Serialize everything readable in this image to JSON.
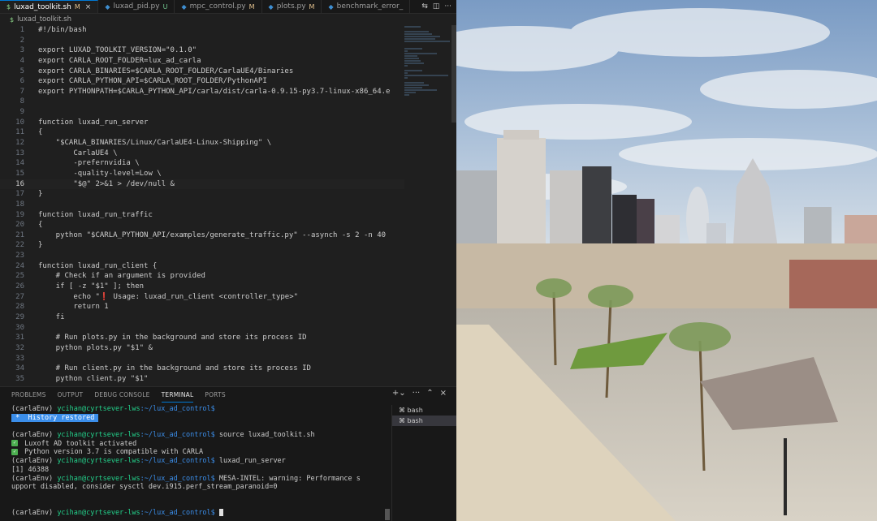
{
  "tabs": [
    {
      "name": "luxad_toolkit.sh",
      "status": "M",
      "type": "sh",
      "active": true
    },
    {
      "name": "luxad_pid.py",
      "status": "U",
      "type": "py",
      "active": false
    },
    {
      "name": "mpc_control.py",
      "status": "M",
      "type": "py",
      "active": false
    },
    {
      "name": "plots.py",
      "status": "M",
      "type": "py",
      "active": false
    },
    {
      "name": "benchmark_error_",
      "status": "",
      "type": "py",
      "active": false
    }
  ],
  "breadcrumb": "luxad_toolkit.sh",
  "code_lines": [
    {
      "n": "1",
      "t": "#!/bin/bash"
    },
    {
      "n": "2",
      "t": ""
    },
    {
      "n": "3",
      "t": "export LUXAD_TOOLKIT_VERSION=\"0.1.0\""
    },
    {
      "n": "4",
      "t": "export CARLA_ROOT_FOLDER=lux_ad_carla"
    },
    {
      "n": "5",
      "t": "export CARLA_BINARIES=$CARLA_ROOT_FOLDER/CarlaUE4/Binaries"
    },
    {
      "n": "6",
      "t": "export CARLA_PYTHON_API=$CARLA_ROOT_FOLDER/PythonAPI"
    },
    {
      "n": "7",
      "t": "export PYTHONPATH=$CARLA_PYTHON_API/carla/dist/carla-0.9.15-py3.7-linux-x86_64.e"
    },
    {
      "n": "8",
      "t": ""
    },
    {
      "n": "9",
      "t": ""
    },
    {
      "n": "10",
      "t": "function luxad_run_server"
    },
    {
      "n": "11",
      "t": "{"
    },
    {
      "n": "12",
      "t": "    \"$CARLA_BINARIES/Linux/CarlaUE4-Linux-Shipping\" \\"
    },
    {
      "n": "13",
      "t": "        CarlaUE4 \\"
    },
    {
      "n": "14",
      "t": "        -prefernvidia \\"
    },
    {
      "n": "15",
      "t": "        -quality-level=Low \\"
    },
    {
      "n": "16",
      "t": "        \"$@\" 2>&1 > /dev/null &"
    },
    {
      "n": "17",
      "t": "}"
    },
    {
      "n": "18",
      "t": ""
    },
    {
      "n": "19",
      "t": "function luxad_run_traffic"
    },
    {
      "n": "20",
      "t": "{"
    },
    {
      "n": "21",
      "t": "    python \"$CARLA_PYTHON_API/examples/generate_traffic.py\" --asynch -s 2 -n 40"
    },
    {
      "n": "22",
      "t": "}"
    },
    {
      "n": "23",
      "t": ""
    },
    {
      "n": "24",
      "t": "function luxad_run_client {"
    },
    {
      "n": "25",
      "t": "    # Check if an argument is provided"
    },
    {
      "n": "26",
      "t": "    if [ -z \"$1\" ]; then"
    },
    {
      "n": "27",
      "t": "        echo \"❗ Usage: luxad_run_client <controller_type>\""
    },
    {
      "n": "28",
      "t": "        return 1"
    },
    {
      "n": "29",
      "t": "    fi"
    },
    {
      "n": "30",
      "t": ""
    },
    {
      "n": "31",
      "t": "    # Run plots.py in the background and store its process ID"
    },
    {
      "n": "32",
      "t": "    python plots.py \"$1\" &"
    },
    {
      "n": "33",
      "t": ""
    },
    {
      "n": "34",
      "t": "    # Run client.py in the background and store its process ID"
    },
    {
      "n": "35",
      "t": "    python client.py \"$1\""
    }
  ],
  "current_line": "16",
  "panel_tabs": [
    "PROBLEMS",
    "OUTPUT",
    "DEBUG CONSOLE",
    "TERMINAL",
    "PORTS"
  ],
  "active_panel_tab": "TERMINAL",
  "terminal": {
    "env": "(carlaEnv)",
    "user_host": "ycihan@cyrtsever-lws",
    "path": ":~/lux_ad_control$",
    "history_restored": " *  History restored ",
    "cmd_source": " source luxad_toolkit.sh",
    "msg_activated": " Luxoft AD toolkit activated",
    "msg_python": " Python version 3.7 is compatible with CARLA",
    "cmd_run_server": " luxad_run_server",
    "job": "[1] 46388",
    "warning_1": " MESA-INTEL: warning: Performance s",
    "warning_2": "upport disabled, consider sysctl dev.i915.perf_stream_paranoid=0"
  },
  "terminal_list": [
    "bash",
    "bash"
  ],
  "colors": {
    "accent": "#0078d4",
    "green": "#23d18b",
    "blue": "#3b8eea",
    "modified": "#e2c08d",
    "untracked": "#73c991"
  }
}
